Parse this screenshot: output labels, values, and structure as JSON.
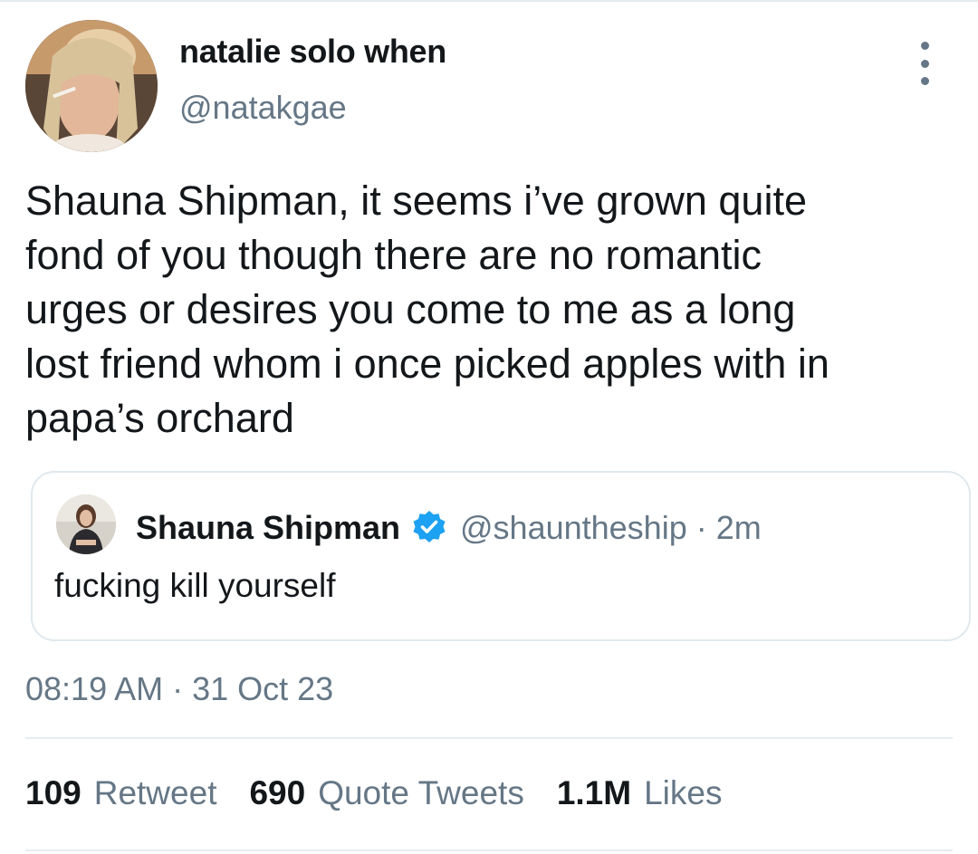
{
  "tweet": {
    "display_name": "natalie solo when",
    "handle": "@natakgae",
    "text_lines": [
      "Shauna Shipman, it seems i’ve grown quite",
      "fond of you though there are no romantic",
      "urges or desires you come to me as a long",
      "lost friend whom i once picked apples with in",
      "papa’s orchard"
    ],
    "more_icon": "more-vertical-icon",
    "timestamp": "08:19 AM · 31 Oct 23"
  },
  "quoted_tweet": {
    "display_name": "Shauna Shipman",
    "verified_icon": "verified-badge-icon",
    "handle_time": "@shauntheship · 2m",
    "text": "fucking kill yourself"
  },
  "stats": [
    {
      "count": "109",
      "label": "Retweet"
    },
    {
      "count": "690",
      "label": "Quote Tweets"
    },
    {
      "count": "1.1M",
      "label": "Likes"
    }
  ],
  "colors": {
    "primary_text": "#14171a",
    "secondary_text": "#657786",
    "border": "#e1e8ed",
    "verified_blue": "#1da1f2"
  }
}
